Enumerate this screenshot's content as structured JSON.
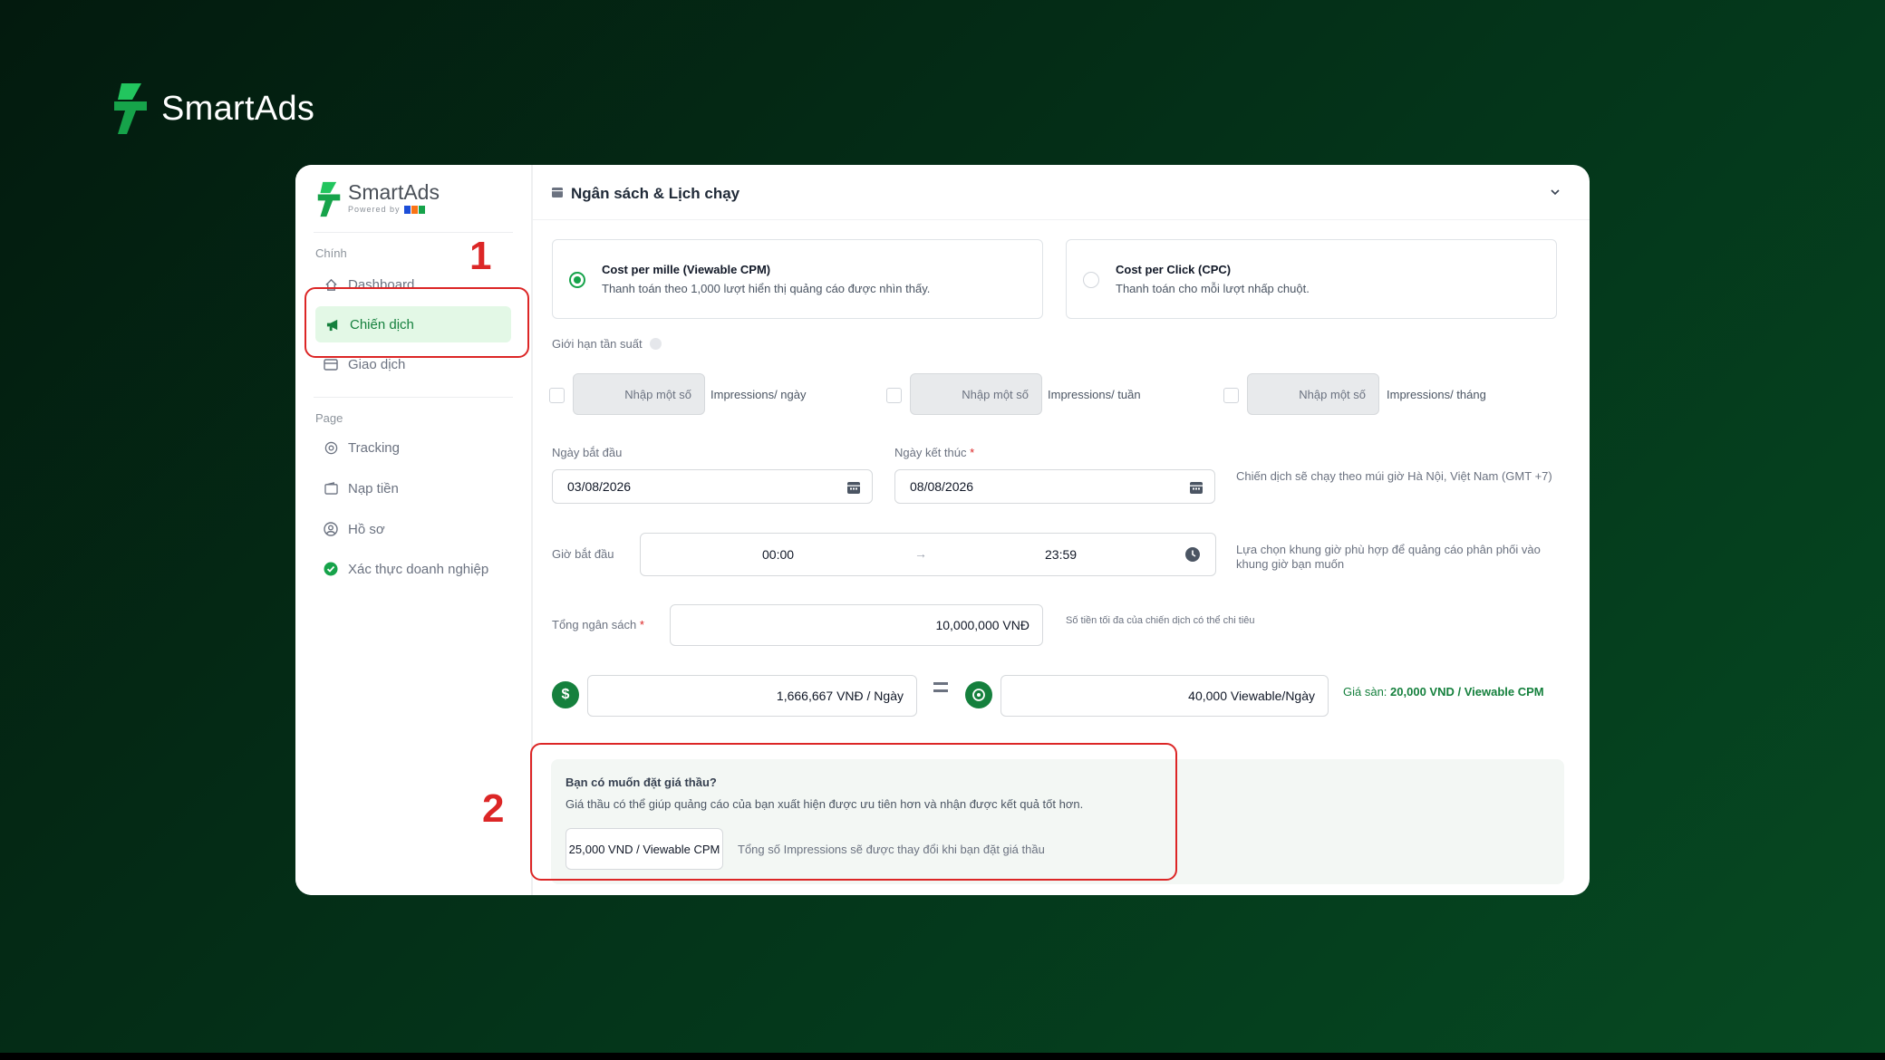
{
  "brand": {
    "name": "SmartAds"
  },
  "sidebar": {
    "logo_name": "SmartAds",
    "logo_sub": "Powered by",
    "section_main": "Chính",
    "section_page": "Page",
    "items": [
      {
        "label": "Dashboard",
        "icon": "home-icon"
      },
      {
        "label": "Chiến dịch",
        "icon": "megaphone-icon"
      },
      {
        "label": "Giao dịch",
        "icon": "card-icon"
      },
      {
        "label": "Tracking",
        "icon": "target-icon"
      },
      {
        "label": "Nạp tiền",
        "icon": "wallet-icon"
      },
      {
        "label": "Hồ sơ",
        "icon": "user-circle-icon"
      },
      {
        "label": "Xác thực doanh nghiệp",
        "icon": "check-circle-icon"
      }
    ]
  },
  "main": {
    "title": "Ngân sách & Lịch chạy",
    "payment": [
      {
        "title": "Cost per mille (Viewable CPM)",
        "desc": "Thanh toán theo 1,000 lượt hiển thị quảng cáo được nhìn thấy.",
        "selected": true
      },
      {
        "title": "Cost per Click (CPC)",
        "desc": "Thanh toán cho mỗi lượt nhấp chuột.",
        "selected": false
      }
    ],
    "frequency": {
      "label": "Giới hạn tần suất",
      "placeholder": "Nhập một số",
      "units": [
        "Impressions/ ngày",
        "Impressions/ tuần",
        "Impressions/ tháng"
      ]
    },
    "start_date_label": "Ngày bắt đầu",
    "start_date": "03/08/2026",
    "end_date_label": "Ngày kết thúc",
    "end_date": "08/08/2026",
    "timezone_hint": "Chiến dịch sẽ chạy theo múi giờ Hà Nội, Việt Nam (GMT +7)",
    "time_label": "Giờ bắt đầu",
    "time_start": "00:00",
    "time_arrow": "→",
    "time_end": "23:59",
    "time_hint": "Lựa chọn khung giờ phù hợp để quảng cáo phân phối vào khung giờ bạn muốn",
    "budget_label": "Tổng ngân sách",
    "budget_value": "10,000,000 VNĐ",
    "budget_hint": "Số tiền tối đa của chiến dịch có thể chi tiêu",
    "daily_budget": "1,666,667 VNĐ / Ngày",
    "daily_views": "40,000 Viewable/Ngày",
    "floor_label": "Giá sàn:",
    "floor_value": "20,000 VND / Viewable CPM",
    "bid": {
      "title": "Bạn có muốn đặt giá thầu?",
      "desc": "Giá thầu có thể giúp quảng cáo của bạn xuất hiện được ưu tiên hơn và nhận được kết quả tốt hơn.",
      "value": "25,000 VND / Viewable CPM",
      "note": "Tổng số Impressions sẽ được thay đổi khi bạn đặt giá thầu"
    }
  },
  "annotations": [
    "1",
    "2"
  ],
  "colors": {
    "accent": "#15803d",
    "annotation": "#dc2626",
    "bg_dark": "#031a0e"
  }
}
